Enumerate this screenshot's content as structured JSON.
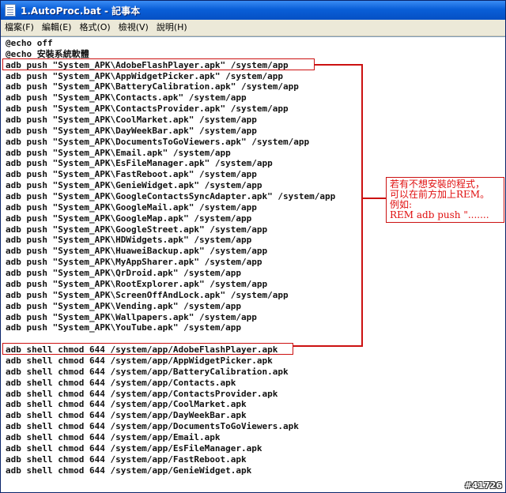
{
  "window": {
    "title": "1.AutoProc.bat - 記事本"
  },
  "menu": [
    "檔案(F)",
    "編輯(E)",
    "格式(O)",
    "檢視(V)",
    "說明(H)"
  ],
  "lines": [
    "@echo off",
    "@echo 安裝系統軟體",
    "adb push \"System_APK\\AdobeFlashPlayer.apk\" /system/app",
    "adb push \"System_APK\\AppWidgetPicker.apk\" /system/app",
    "adb push \"System_APK\\BatteryCalibration.apk\" /system/app",
    "adb push \"System_APK\\Contacts.apk\" /system/app",
    "adb push \"System_APK\\ContactsProvider.apk\" /system/app",
    "adb push \"System_APK\\CoolMarket.apk\" /system/app",
    "adb push \"System_APK\\DayWeekBar.apk\" /system/app",
    "adb push \"System_APK\\DocumentsToGoViewers.apk\" /system/app",
    "adb push \"System_APK\\Email.apk\" /system/app",
    "adb push \"System_APK\\EsFileManager.apk\" /system/app",
    "adb push \"System_APK\\FastReboot.apk\" /system/app",
    "adb push \"System_APK\\GenieWidget.apk\" /system/app",
    "adb push \"System_APK\\GoogleContactsSyncAdapter.apk\" /system/app",
    "adb push \"System_APK\\GoogleMail.apk\" /system/app",
    "adb push \"System_APK\\GoogleMap.apk\" /system/app",
    "adb push \"System_APK\\GoogleStreet.apk\" /system/app",
    "adb push \"System_APK\\HDWidgets.apk\" /system/app",
    "adb push \"System_APK\\HuaweiBackup.apk\" /system/app",
    "adb push \"System_APK\\MyAppSharer.apk\" /system/app",
    "adb push \"System_APK\\QrDroid.apk\" /system/app",
    "adb push \"System_APK\\RootExplorer.apk\" /system/app",
    "adb push \"System_APK\\ScreenOffAndLock.apk\" /system/app",
    "adb push \"System_APK\\Vending.apk\" /system/app",
    "adb push \"System_APK\\Wallpapers.apk\" /system/app",
    "adb push \"System_APK\\YouTube.apk\" /system/app",
    "",
    "adb shell chmod 644 /system/app/AdobeFlashPlayer.apk",
    "adb shell chmod 644 /system/app/AppWidgetPicker.apk",
    "adb shell chmod 644 /system/app/BatteryCalibration.apk",
    "adb shell chmod 644 /system/app/Contacts.apk",
    "adb shell chmod 644 /system/app/ContactsProvider.apk",
    "adb shell chmod 644 /system/app/CoolMarket.apk",
    "adb shell chmod 644 /system/app/DayWeekBar.apk",
    "adb shell chmod 644 /system/app/DocumentsToGoViewers.apk",
    "adb shell chmod 644 /system/app/Email.apk",
    "adb shell chmod 644 /system/app/EsFileManager.apk",
    "adb shell chmod 644 /system/app/FastReboot.apk",
    "adb shell chmod 644 /system/app/GenieWidget.apk"
  ],
  "annotation": {
    "lines": [
      "若有不想安裝的程式，",
      "可以在前方加上REM。",
      "例如:",
      "REM adb push \"......."
    ]
  },
  "watermark": "#41726",
  "colors": {
    "annotation": "#e01010",
    "titlebar": "#0a5fd8"
  }
}
